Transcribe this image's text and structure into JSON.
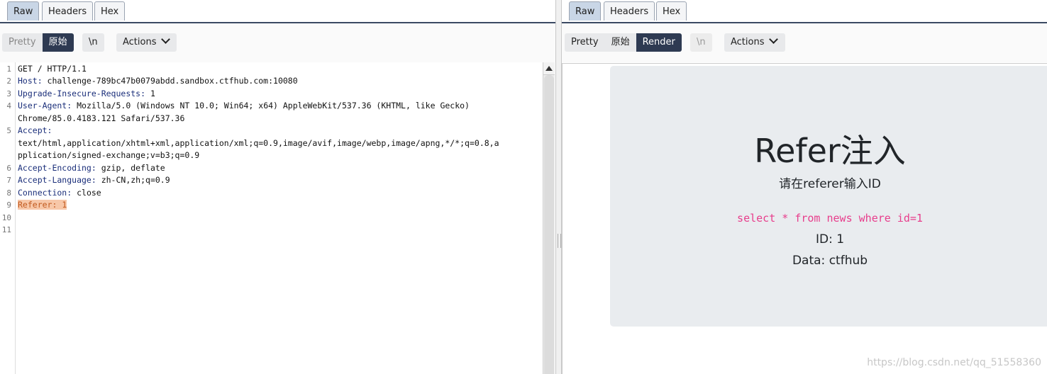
{
  "left": {
    "tabs": [
      "Raw",
      "Headers",
      "Hex"
    ],
    "active_tab": "Raw",
    "view_modes": [
      "Pretty",
      "原始"
    ],
    "active_view": "原始",
    "newline_label": "\\n",
    "actions_label": "Actions",
    "line_numbers": [
      "1",
      "2",
      "3",
      "4",
      "5",
      "6",
      "7",
      "8",
      "9",
      "10",
      "11"
    ],
    "lines": [
      {
        "key": "",
        "val": "GET / HTTP/1.1"
      },
      {
        "key": "Host:",
        "val": " challenge-789bc47b0079abdd.sandbox.ctfhub.com:10080"
      },
      {
        "key": "Upgrade-Insecure-Requests:",
        "val": " 1"
      },
      {
        "key": "User-Agent:",
        "val": " Mozilla/5.0 (Windows NT 10.0; Win64; x64) AppleWebKit/537.36 (KHTML, like Gecko)"
      },
      {
        "key": "",
        "val": "Chrome/85.0.4183.121 Safari/537.36"
      },
      {
        "key": "Accept:",
        "val": ""
      },
      {
        "key": "",
        "val": "text/html,application/xhtml+xml,application/xml;q=0.9,image/avif,image/webp,image/apng,*/*;q=0.8,a"
      },
      {
        "key": "",
        "val": "pplication/signed-exchange;v=b3;q=0.9"
      },
      {
        "key": "Accept-Encoding:",
        "val": " gzip, deflate"
      },
      {
        "key": "Accept-Language:",
        "val": " zh-CN,zh;q=0.9"
      },
      {
        "key": "Connection:",
        "val": " close"
      },
      {
        "key": "Referer:",
        "val": " 1"
      }
    ]
  },
  "right": {
    "tabs": [
      "Raw",
      "Headers",
      "Hex"
    ],
    "active_tab": "Raw",
    "view_modes": [
      "Pretty",
      "原始",
      "Render"
    ],
    "active_view": "Render",
    "newline_label": "\\n",
    "actions_label": "Actions",
    "render": {
      "title": "Refer注入",
      "subtitle": "请在referer输入ID",
      "sql": "select * from news where id=1",
      "id_line": "ID: 1",
      "data_line": "Data: ctfhub"
    }
  },
  "watermark": "https://blog.csdn.net/qq_51558360"
}
